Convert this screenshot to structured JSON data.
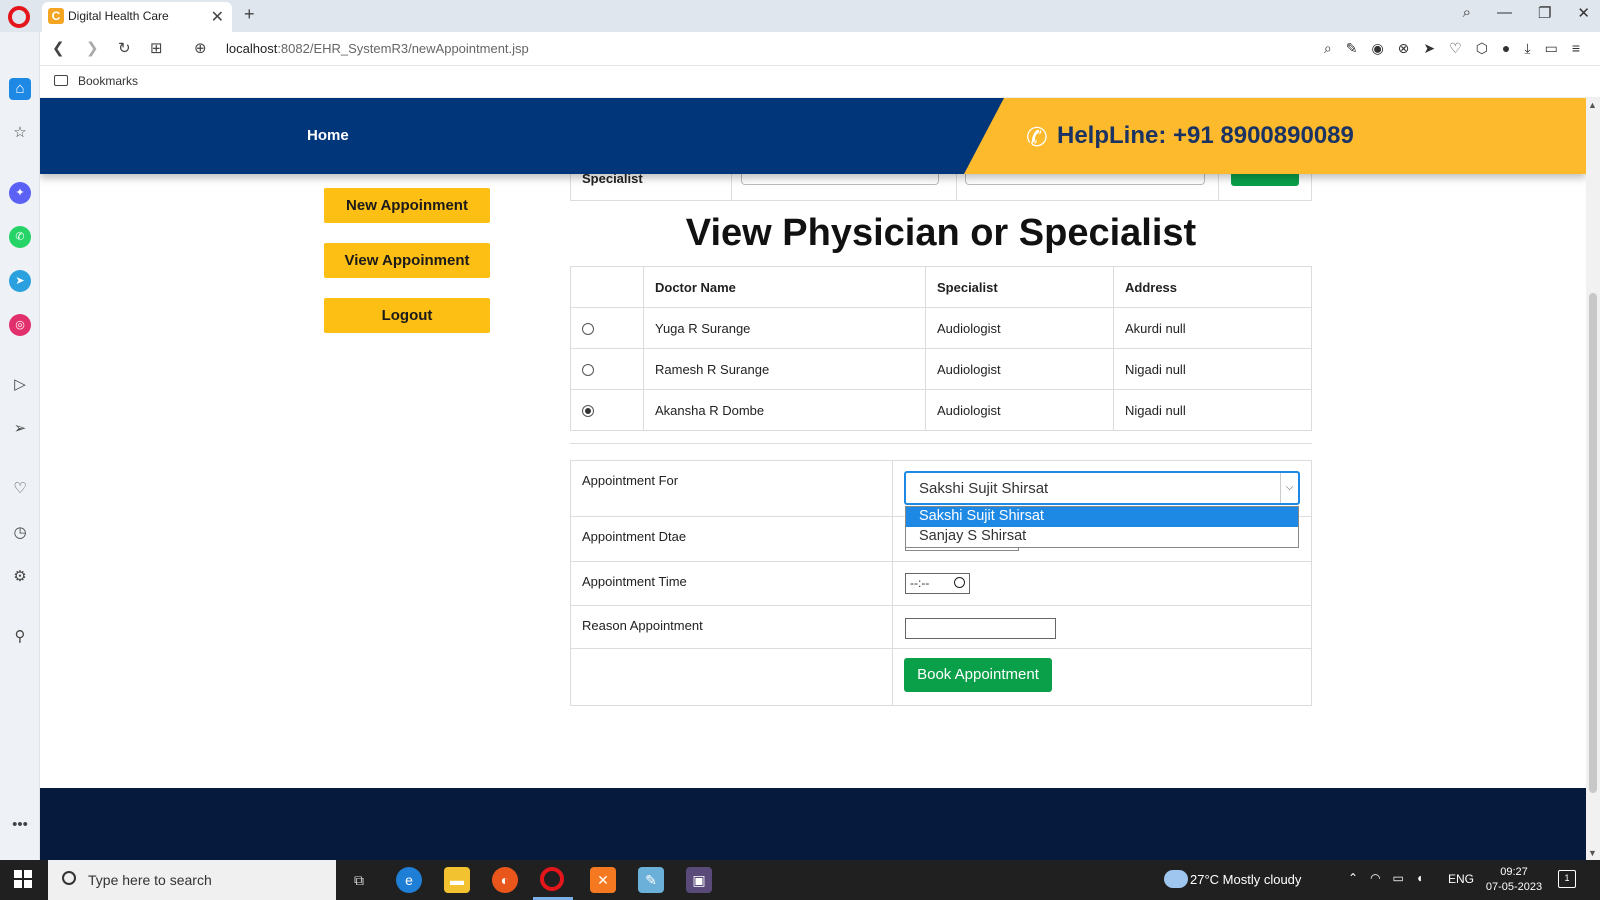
{
  "browser": {
    "tab_title": "Digital Health Care",
    "tab_favicon": "C",
    "url_host": "localhost",
    "url_path": ":8082/EHR_SystemR3/newAppointment.jsp",
    "bookmarks_label": "Bookmarks"
  },
  "header": {
    "home_label": "Home",
    "helpline": "HelpLine: +91 8900890089"
  },
  "menu": {
    "new_appointment": "New Appoinment",
    "view_appointment": "View Appoinment",
    "logout": "Logout"
  },
  "search": {
    "label": "Specialist"
  },
  "page_title": "View Physician or Specialist",
  "doctor_table": {
    "headers": [
      "",
      "Doctor Name",
      "Specialist",
      "Address"
    ],
    "rows": [
      {
        "name": "Yuga R Surange",
        "specialist": "Audiologist",
        "address": "Akurdi null",
        "selected": false
      },
      {
        "name": "Ramesh R Surange",
        "specialist": "Audiologist",
        "address": "Nigadi null",
        "selected": false
      },
      {
        "name": "Akansha R Dombe",
        "specialist": "Audiologist",
        "address": "Nigadi null",
        "selected": true
      }
    ]
  },
  "appointment_form": {
    "for_label": "Appointment For",
    "date_label": "Appointment Dtae",
    "time_label": "Appointment Time",
    "reason_label": "Reason Appointment",
    "selected_patient": "Sakshi Sujit Shirsat",
    "patient_options": [
      "Sakshi Sujit Shirsat",
      "Sanjay S Shirsat"
    ],
    "time_value": "--:--",
    "book_button": "Book Appointment"
  },
  "taskbar": {
    "search_placeholder": "Type here to search",
    "weather": "27°C  Mostly cloudy",
    "language": "ENG",
    "time": "09:27",
    "date": "07-05-2023",
    "notification_count": "1"
  },
  "colors": {
    "header_bg": "#02367a",
    "helpline_bg": "#fdba2d",
    "menu_button_bg": "#fdbf14",
    "book_button_bg": "#0aa04a",
    "footer_bg": "#051a3d"
  }
}
